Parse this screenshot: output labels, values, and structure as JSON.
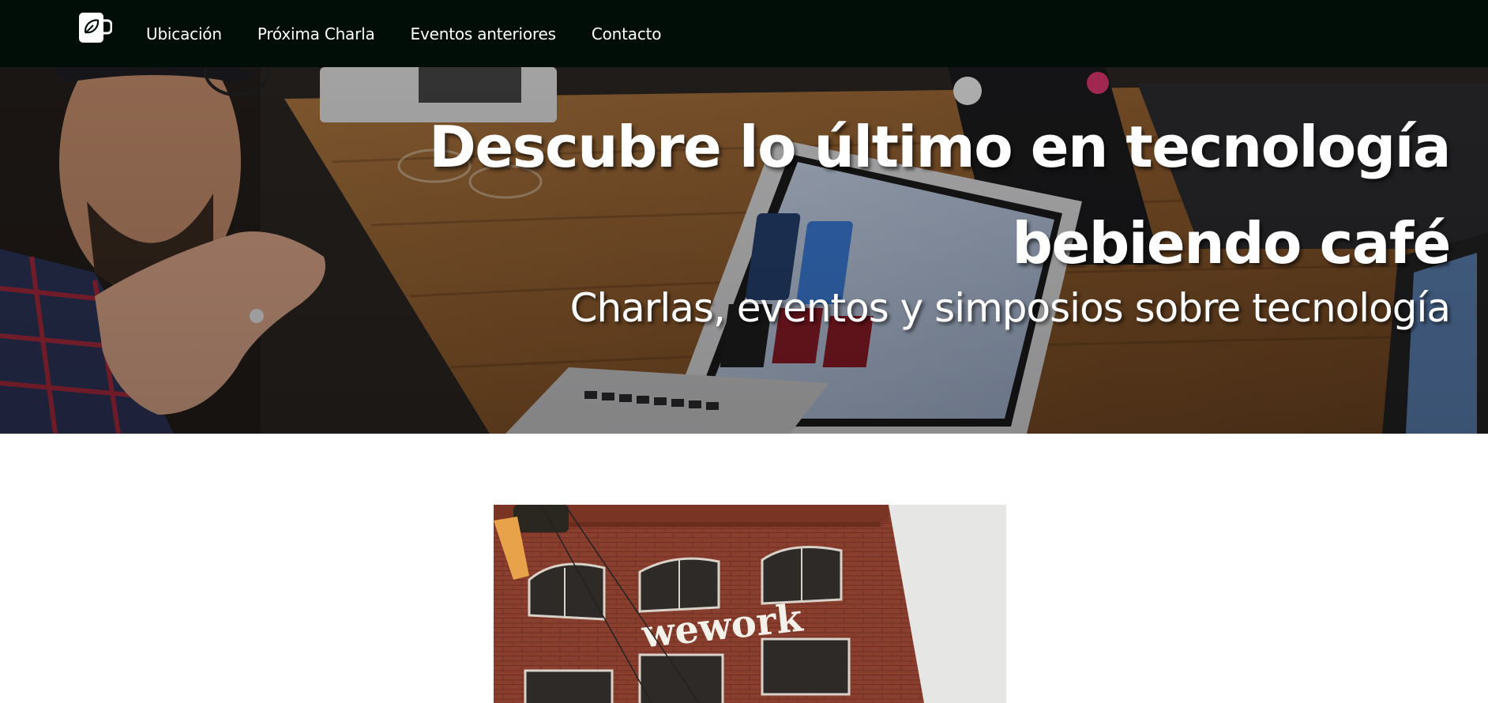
{
  "nav": {
    "logo_icon": "coffee-cup-leaf-icon",
    "links": [
      {
        "label": "Ubicación"
      },
      {
        "label": "Próxima Charla"
      },
      {
        "label": "Eventos anteriores"
      },
      {
        "label": "Contacto"
      }
    ]
  },
  "hero": {
    "title": "Descubre lo último en tecnología bebiendo café",
    "subtitle": "Charlas, eventos y simposios sobre tecnología"
  },
  "venue": {
    "sign_text": "wework"
  },
  "colors": {
    "navbar_bg": "#010d07",
    "text_light": "#ffffff",
    "brick": "#8a3f2e"
  }
}
